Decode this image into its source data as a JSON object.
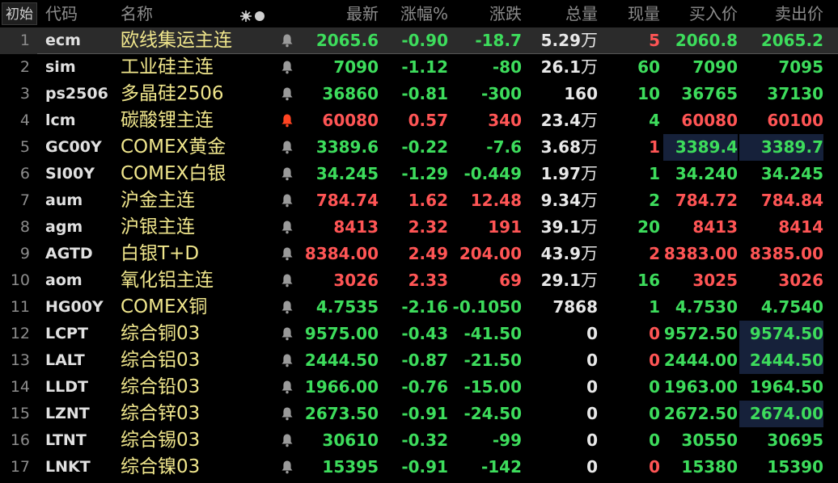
{
  "header": {
    "reset_label": "初始",
    "code": "代码",
    "name": "名称",
    "last": "最新",
    "pct": "涨幅%",
    "change": "涨跌",
    "volume": "总量",
    "current_volume": "现量",
    "bid": "买入价",
    "ask": "卖出价"
  },
  "colors": {
    "up": "#ff5555",
    "down": "#3ddc5c",
    "flat": "#e8e8e8",
    "name": "#f0e68c",
    "alert_active": "#ff4422",
    "alert_idle": "#9a9a9a"
  },
  "rows": [
    {
      "idx": "1",
      "code": "ecm",
      "name": "欧线集运主连",
      "alert": false,
      "last": "2065.6",
      "pct": "-0.90",
      "chg": "-18.7",
      "vol": "5.29",
      "vol_unit": "万",
      "cur": "5",
      "cur_dir": "up",
      "bid": "2060.8",
      "ask": "2065.2",
      "dir": "down",
      "bid_dir": "down",
      "ask_dir": "down",
      "selected": true
    },
    {
      "idx": "2",
      "code": "sim",
      "name": "工业硅主连",
      "alert": false,
      "last": "7090",
      "pct": "-1.12",
      "chg": "-80",
      "vol": "26.1",
      "vol_unit": "万",
      "cur": "60",
      "cur_dir": "down",
      "bid": "7090",
      "ask": "7095",
      "dir": "down",
      "bid_dir": "down",
      "ask_dir": "down"
    },
    {
      "idx": "3",
      "code": "ps2506",
      "name": "多晶硅2506",
      "alert": false,
      "last": "36860",
      "pct": "-0.81",
      "chg": "-300",
      "vol": "160",
      "vol_unit": "",
      "cur": "10",
      "cur_dir": "down",
      "bid": "36765",
      "ask": "37130",
      "dir": "down",
      "bid_dir": "down",
      "ask_dir": "down"
    },
    {
      "idx": "4",
      "code": "lcm",
      "name": "碳酸锂主连",
      "alert": true,
      "last": "60080",
      "pct": "0.57",
      "chg": "340",
      "vol": "23.4",
      "vol_unit": "万",
      "cur": "4",
      "cur_dir": "down",
      "bid": "60080",
      "ask": "60100",
      "dir": "up",
      "bid_dir": "up",
      "ask_dir": "up"
    },
    {
      "idx": "5",
      "code": "GC00Y",
      "name": "COMEX黄金",
      "alert": false,
      "last": "3389.6",
      "pct": "-0.22",
      "chg": "-7.6",
      "vol": "3.68",
      "vol_unit": "万",
      "cur": "1",
      "cur_dir": "up",
      "bid": "3389.4",
      "ask": "3389.7",
      "dir": "down",
      "bid_dir": "down",
      "ask_dir": "down",
      "bid_hl": true,
      "ask_hl": true
    },
    {
      "idx": "6",
      "code": "SI00Y",
      "name": "COMEX白银",
      "alert": false,
      "last": "34.245",
      "pct": "-1.29",
      "chg": "-0.449",
      "vol": "1.97",
      "vol_unit": "万",
      "cur": "1",
      "cur_dir": "down",
      "bid": "34.240",
      "ask": "34.245",
      "dir": "down",
      "bid_dir": "down",
      "ask_dir": "down"
    },
    {
      "idx": "7",
      "code": "aum",
      "name": "沪金主连",
      "alert": false,
      "last": "784.74",
      "pct": "1.62",
      "chg": "12.48",
      "vol": "9.34",
      "vol_unit": "万",
      "cur": "2",
      "cur_dir": "down",
      "bid": "784.72",
      "ask": "784.84",
      "dir": "up",
      "bid_dir": "up",
      "ask_dir": "up"
    },
    {
      "idx": "8",
      "code": "agm",
      "name": "沪银主连",
      "alert": false,
      "last": "8413",
      "pct": "2.32",
      "chg": "191",
      "vol": "39.1",
      "vol_unit": "万",
      "cur": "20",
      "cur_dir": "down",
      "bid": "8413",
      "ask": "8414",
      "dir": "up",
      "bid_dir": "up",
      "ask_dir": "up"
    },
    {
      "idx": "9",
      "code": "AGTD",
      "name": "白银T+D",
      "alert": false,
      "last": "8384.00",
      "pct": "2.49",
      "chg": "204.00",
      "vol": "43.9",
      "vol_unit": "万",
      "cur": "2",
      "cur_dir": "up",
      "bid": "8383.00",
      "ask": "8385.00",
      "dir": "up",
      "bid_dir": "up",
      "ask_dir": "up"
    },
    {
      "idx": "10",
      "code": "aom",
      "name": "氧化铝主连",
      "alert": false,
      "last": "3026",
      "pct": "2.33",
      "chg": "69",
      "vol": "29.1",
      "vol_unit": "万",
      "cur": "16",
      "cur_dir": "down",
      "bid": "3025",
      "ask": "3026",
      "dir": "up",
      "bid_dir": "up",
      "ask_dir": "up"
    },
    {
      "idx": "11",
      "code": "HG00Y",
      "name": "COMEX铜",
      "alert": false,
      "last": "4.7535",
      "pct": "-2.16",
      "chg": "-0.1050",
      "vol": "7868",
      "vol_unit": "",
      "cur": "1",
      "cur_dir": "down",
      "bid": "4.7530",
      "ask": "4.7540",
      "dir": "down",
      "bid_dir": "down",
      "ask_dir": "down"
    },
    {
      "idx": "12",
      "code": "LCPT",
      "name": "综合铜03",
      "alert": false,
      "last": "9575.00",
      "pct": "-0.43",
      "chg": "-41.50",
      "vol": "0",
      "vol_unit": "",
      "cur": "0",
      "cur_dir": "up",
      "bid": "9572.50",
      "ask": "9574.50",
      "dir": "down",
      "bid_dir": "down",
      "ask_dir": "down",
      "ask_hl": true
    },
    {
      "idx": "13",
      "code": "LALT",
      "name": "综合铝03",
      "alert": false,
      "last": "2444.50",
      "pct": "-0.87",
      "chg": "-21.50",
      "vol": "0",
      "vol_unit": "",
      "cur": "0",
      "cur_dir": "up",
      "bid": "2444.00",
      "ask": "2444.50",
      "dir": "down",
      "bid_dir": "down",
      "ask_dir": "down",
      "ask_hl": true
    },
    {
      "idx": "14",
      "code": "LLDT",
      "name": "综合铅03",
      "alert": false,
      "last": "1966.00",
      "pct": "-0.76",
      "chg": "-15.00",
      "vol": "0",
      "vol_unit": "",
      "cur": "0",
      "cur_dir": "down",
      "bid": "1963.00",
      "ask": "1964.50",
      "dir": "down",
      "bid_dir": "down",
      "ask_dir": "down"
    },
    {
      "idx": "15",
      "code": "LZNT",
      "name": "综合锌03",
      "alert": false,
      "last": "2673.50",
      "pct": "-0.91",
      "chg": "-24.50",
      "vol": "0",
      "vol_unit": "",
      "cur": "0",
      "cur_dir": "down",
      "bid": "2672.50",
      "ask": "2674.00",
      "dir": "down",
      "bid_dir": "down",
      "ask_dir": "down",
      "ask_hl": true
    },
    {
      "idx": "16",
      "code": "LTNT",
      "name": "综合锡03",
      "alert": false,
      "last": "30610",
      "pct": "-0.32",
      "chg": "-99",
      "vol": "0",
      "vol_unit": "",
      "cur": "0",
      "cur_dir": "down",
      "bid": "30550",
      "ask": "30695",
      "dir": "down",
      "bid_dir": "down",
      "ask_dir": "down"
    },
    {
      "idx": "17",
      "code": "LNKT",
      "name": "综合镍03",
      "alert": false,
      "last": "15395",
      "pct": "-0.91",
      "chg": "-142",
      "vol": "0",
      "vol_unit": "",
      "cur": "0",
      "cur_dir": "up",
      "bid": "15380",
      "ask": "15390",
      "dir": "down",
      "bid_dir": "down",
      "ask_dir": "down"
    }
  ]
}
